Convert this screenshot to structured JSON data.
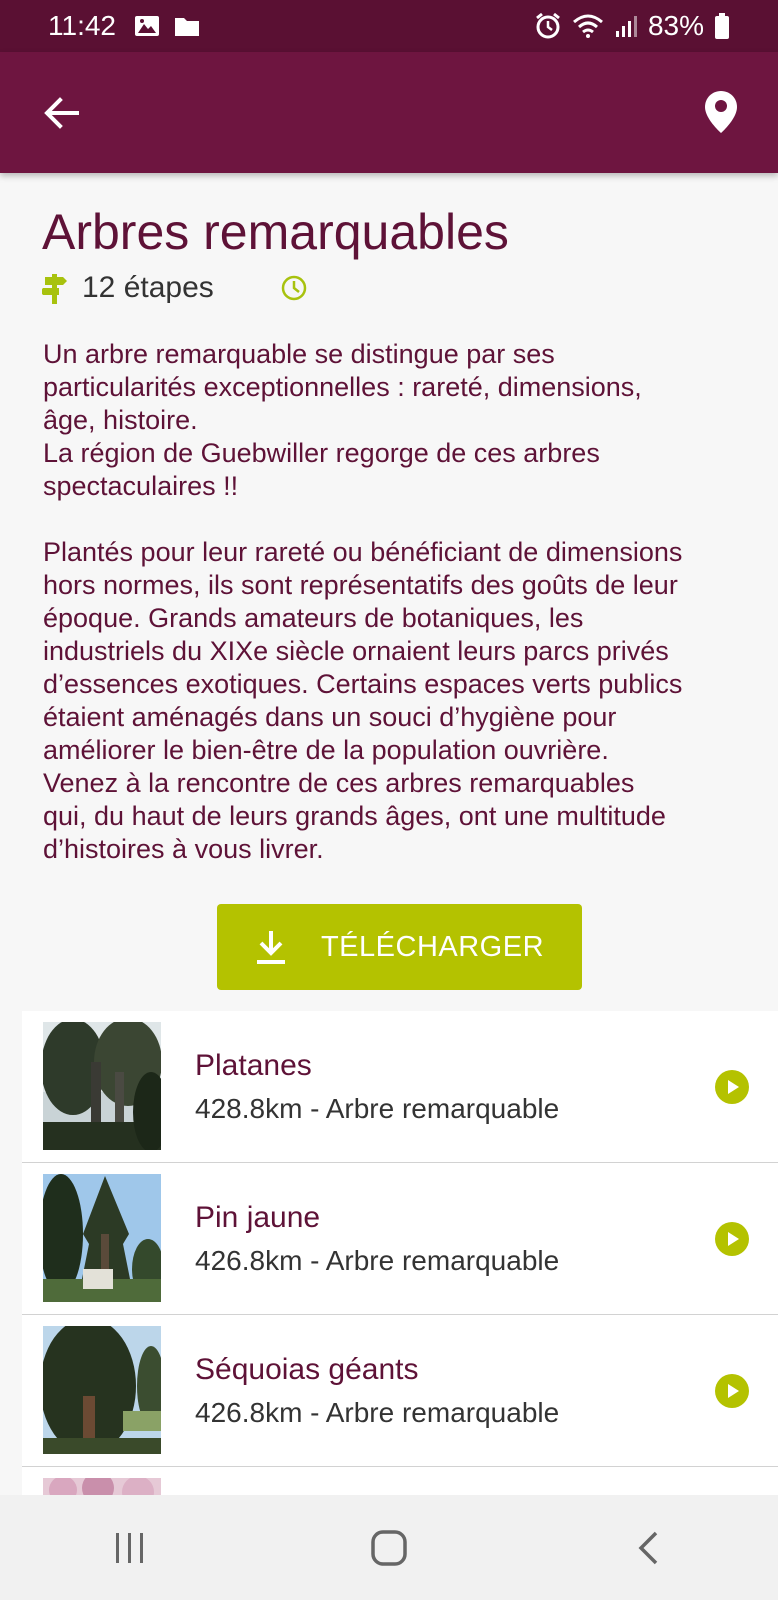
{
  "status_bar": {
    "time": "11:42",
    "battery": "83%",
    "icons": [
      "image-icon",
      "folder-icon",
      "alarm-icon",
      "wifi-icon",
      "signal-icon",
      "battery-icon"
    ]
  },
  "app_bar": {
    "back_icon": "arrow-left-icon",
    "location_icon": "map-pin-icon"
  },
  "tour": {
    "title": "Arbres remarquables",
    "steps": "12 étapes",
    "steps_icon": "signpost-icon",
    "duration_icon": "clock-icon",
    "description_1": [
      "Un arbre remarquable se distingue par ses",
      "particularités exceptionnelles : rareté, dimensions,",
      "âge, histoire.",
      "La région de Guebwiller regorge de ces arbres",
      "spectaculaires !!"
    ],
    "description_2": [
      "Plantés pour leur rareté ou bénéficiant de dimensions",
      "hors normes, ils sont représentatifs des goûts de leur",
      "époque. Grands amateurs de botaniques, les",
      "industriels du XIXe siècle ornaient leurs parcs privés",
      "d’essences exotiques. Certains espaces verts publics",
      "étaient aménagés dans un souci d’hygiène pour",
      "améliorer le bien-être de la population ouvrière.",
      "Venez à la rencontre de ces arbres remarquables",
      "qui, du haut de leurs grands âges, ont une multitude",
      "d’histoires à vous livrer."
    ],
    "download_label": "TÉLÉCHARGER",
    "download_icon": "download-icon"
  },
  "steps_list": [
    {
      "name": "Platanes",
      "subtitle": "428.8km - Arbre remarquable",
      "action_icon": "play-circle-icon"
    },
    {
      "name": "Pin jaune",
      "subtitle": "426.8km - Arbre remarquable",
      "action_icon": "play-circle-icon"
    },
    {
      "name": "Séquoias géants",
      "subtitle": "426.8km - Arbre remarquable",
      "action_icon": "play-circle-icon"
    }
  ],
  "colors": {
    "primary": "#6e1540",
    "status_bar": "#5a1033",
    "accent": "#b4c200",
    "text_primary": "#5e1237",
    "text_secondary": "#333333"
  },
  "nav_bar": {
    "icons": [
      "recent-apps-icon",
      "home-icon",
      "back-icon"
    ]
  }
}
